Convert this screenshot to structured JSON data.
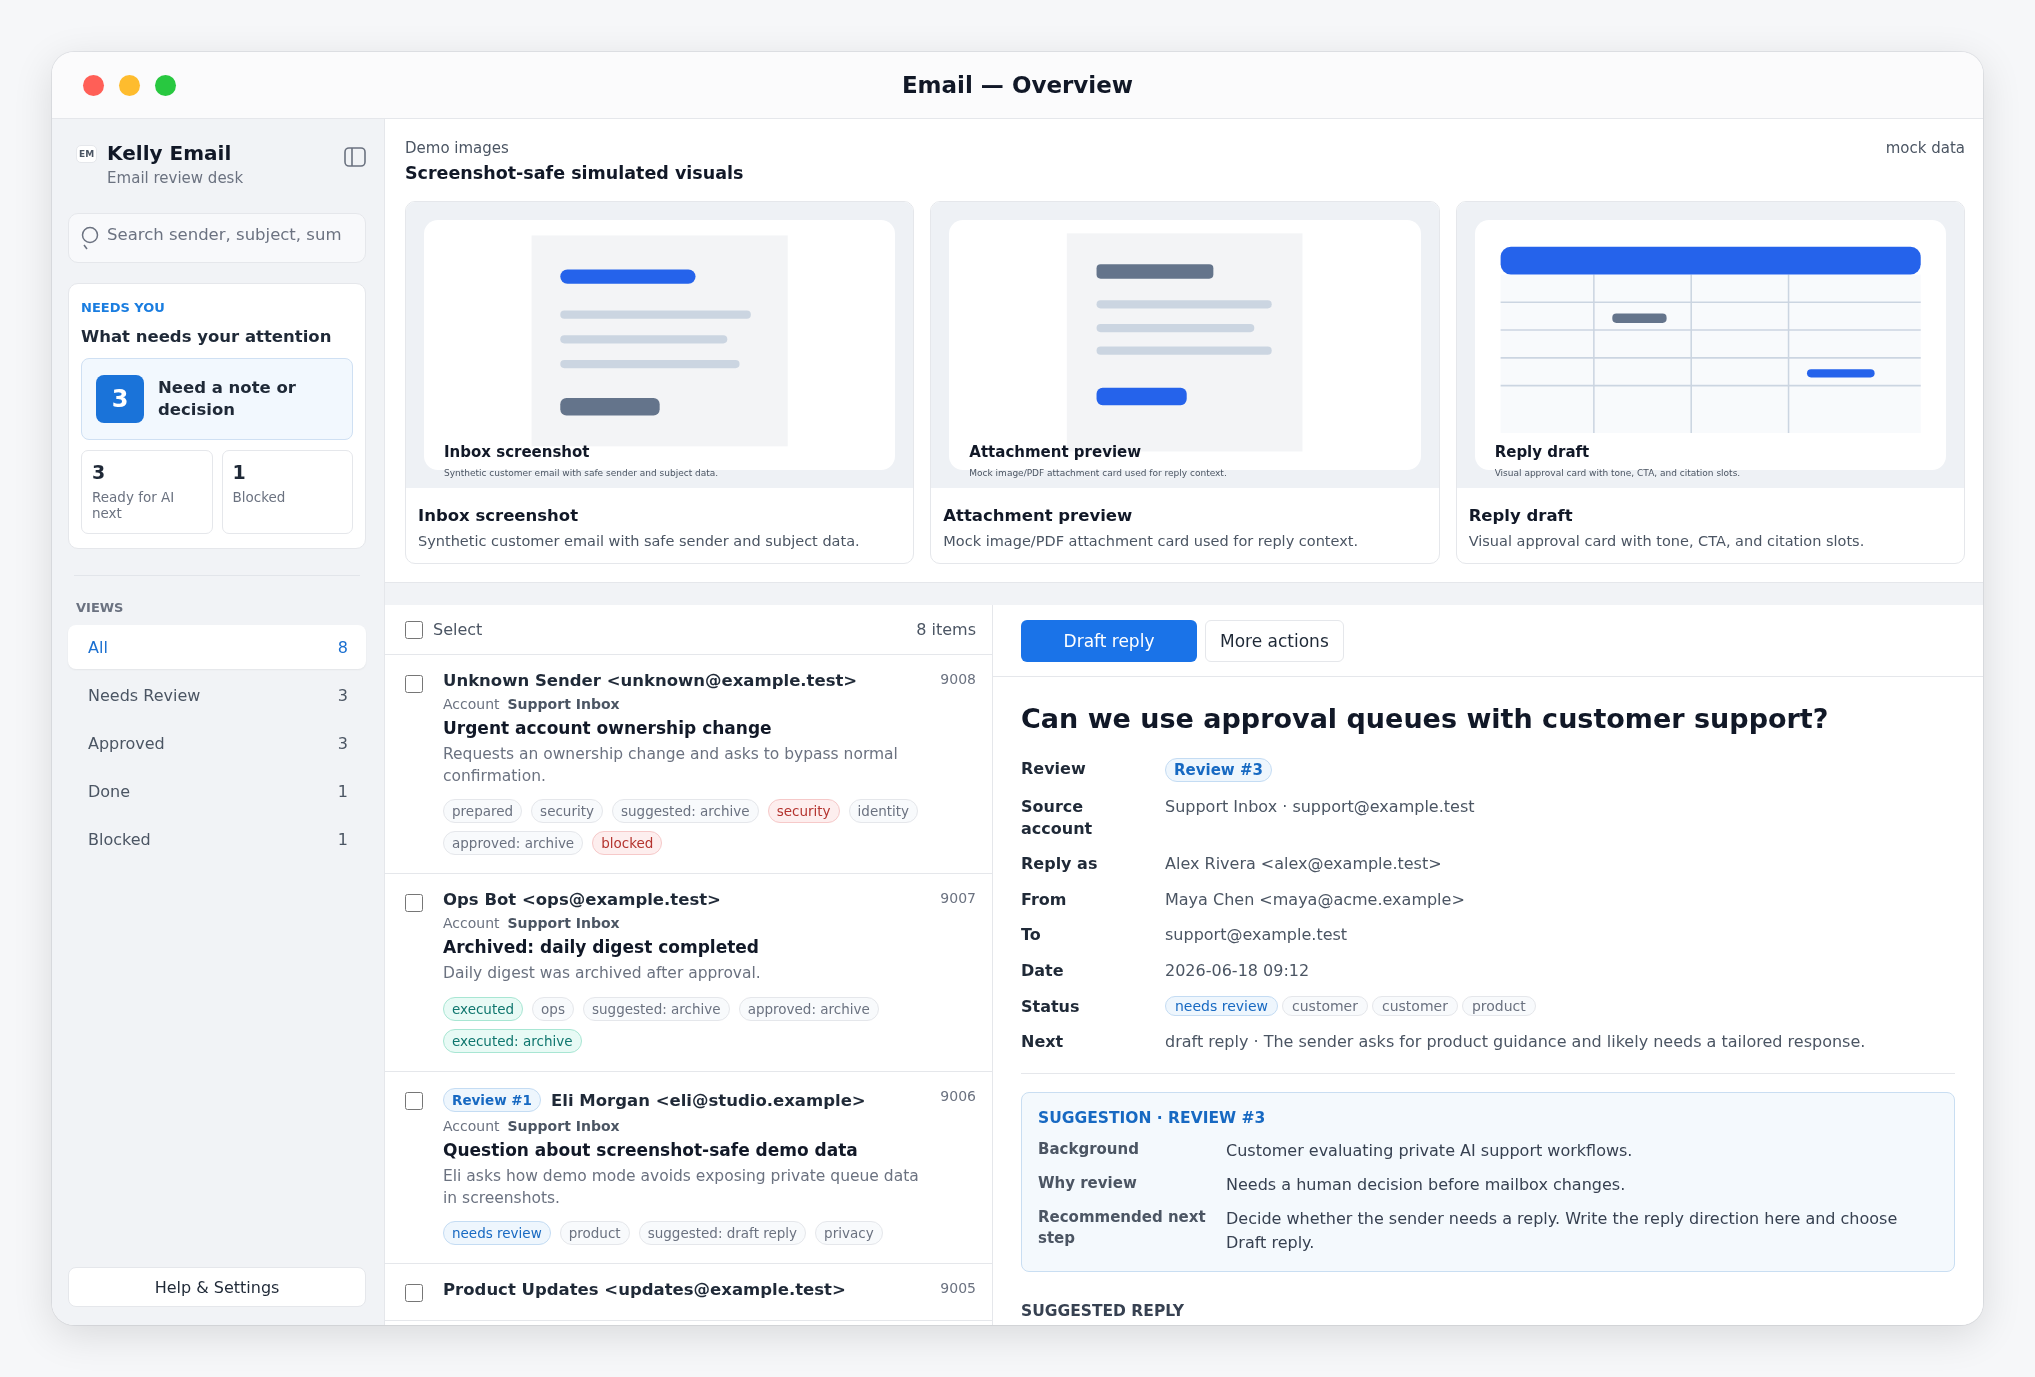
{
  "window": {
    "title": "Email — Overview"
  },
  "sidebar": {
    "logo": "EM",
    "app_name": "Kelly Email",
    "subtitle": "Email review desk",
    "search": {
      "placeholder": "Search sender, subject, sum"
    },
    "needs_you": {
      "eyebrow": "NEEDS YOU",
      "title": "What needs your attention",
      "primary": {
        "count": "3",
        "label": "Need a note or decision"
      },
      "stats": [
        {
          "count": "3",
          "label": "Ready for AI next"
        },
        {
          "count": "1",
          "label": "Blocked"
        }
      ]
    },
    "views_heading": "VIEWS",
    "views": [
      {
        "label": "All",
        "count": "8",
        "selected": true
      },
      {
        "label": "Needs Review",
        "count": "3",
        "selected": false
      },
      {
        "label": "Approved",
        "count": "3",
        "selected": false
      },
      {
        "label": "Done",
        "count": "1",
        "selected": false
      },
      {
        "label": "Blocked",
        "count": "1",
        "selected": false
      }
    ],
    "footer_button": "Help & Settings"
  },
  "demo": {
    "eyebrow": "Demo images",
    "title": "Screenshot-safe simulated visuals",
    "badge": "mock data",
    "cards": [
      {
        "kind": "inbox",
        "overlay_title": "Inbox screenshot",
        "overlay_caption": "Synthetic customer email with safe sender and subject data.",
        "title": "Inbox screenshot",
        "description": "Synthetic customer email with safe sender and subject data."
      },
      {
        "kind": "attachment",
        "overlay_title": "Attachment preview",
        "overlay_caption": "Mock image/PDF attachment card used for reply context.",
        "title": "Attachment preview",
        "description": "Mock image/PDF attachment card used for reply context."
      },
      {
        "kind": "table",
        "overlay_title": "Reply draft",
        "overlay_caption": "Visual approval card with tone, CTA, and citation slots.",
        "title": "Reply draft",
        "description": "Visual approval card with tone, CTA, and citation slots."
      }
    ]
  },
  "list": {
    "select_label": "Select",
    "select_checked": false,
    "count": "8 items",
    "rows": [
      {
        "checked": false,
        "sender": "Unknown Sender <unknown@example.test>",
        "number": "9008",
        "account_label": "Account",
        "account": "Support Inbox",
        "subject": "Urgent account ownership change",
        "summary": "Requests an ownership change and asks to bypass normal confirmation.",
        "tags": [
          {
            "label": "prepared",
            "kind": "neutral"
          },
          {
            "label": "security",
            "kind": "neutral"
          },
          {
            "label": "suggested: archive",
            "kind": "neutral"
          },
          {
            "label": "security",
            "kind": "danger"
          },
          {
            "label": "identity",
            "kind": "neutral"
          },
          {
            "label": "approved: archive",
            "kind": "neutral"
          },
          {
            "label": "blocked",
            "kind": "danger"
          }
        ]
      },
      {
        "checked": false,
        "sender": "Ops Bot <ops@example.test>",
        "number": "9007",
        "account_label": "Account",
        "account": "Support Inbox",
        "subject": "Archived: daily digest completed",
        "summary": "Daily digest was archived after approval.",
        "tags": [
          {
            "label": "executed",
            "kind": "success"
          },
          {
            "label": "ops",
            "kind": "neutral"
          },
          {
            "label": "suggested: archive",
            "kind": "neutral"
          },
          {
            "label": "approved: archive",
            "kind": "neutral"
          },
          {
            "label": "executed: archive",
            "kind": "success"
          }
        ]
      },
      {
        "checked": false,
        "review_badge": "Review #1",
        "sender": "Eli Morgan <eli@studio.example>",
        "number": "9006",
        "account_label": "Account",
        "account": "Support Inbox",
        "subject": "Question about screenshot-safe demo data",
        "summary": "Eli asks how demo mode avoids exposing private queue data in screenshots.",
        "tags": [
          {
            "label": "needs review",
            "kind": "info"
          },
          {
            "label": "product",
            "kind": "neutral"
          },
          {
            "label": "suggested: draft reply",
            "kind": "neutral"
          },
          {
            "label": "privacy",
            "kind": "neutral"
          }
        ]
      },
      {
        "checked": false,
        "sender": "Product Updates <updates@example.test>",
        "number": "9005"
      }
    ]
  },
  "detail": {
    "actions": [
      {
        "label": "Draft reply",
        "kind": "primary"
      },
      {
        "label": "More actions",
        "kind": "secondary"
      }
    ],
    "title": "Can we use approval queues with customer support?",
    "fields": [
      {
        "label": "Review",
        "kind": "pill",
        "value": "Review #3"
      },
      {
        "label": "Source account",
        "kind": "text",
        "value": "Support Inbox · support@example.test"
      },
      {
        "label": "Reply as",
        "kind": "text",
        "value": "Alex Rivera <alex@example.test>"
      },
      {
        "label": "From",
        "kind": "text",
        "value": "Maya Chen <maya@acme.example>"
      },
      {
        "label": "To",
        "kind": "text",
        "value": "support@example.test"
      },
      {
        "label": "Date",
        "kind": "text",
        "value": "2026-06-18 09:12"
      },
      {
        "label": "Status",
        "kind": "tags",
        "tags": [
          {
            "label": "needs review",
            "kind": "info"
          },
          {
            "label": "customer",
            "kind": "neutral"
          },
          {
            "label": "customer",
            "kind": "neutral"
          },
          {
            "label": "product",
            "kind": "neutral"
          }
        ]
      },
      {
        "label": "Next",
        "kind": "text",
        "value": "draft reply · The sender asks for product guidance and likely needs a tailored response."
      }
    ],
    "suggestion": {
      "heading": "SUGGESTION · REVIEW #3",
      "rows": [
        {
          "label": "Background",
          "value": "Customer evaluating private AI support workflows."
        },
        {
          "label": "Why review",
          "value": "Needs a human decision before mailbox changes."
        },
        {
          "label": "Recommended next step",
          "value": "Decide whether the sender needs a reply. Write the reply direction here and choose Draft reply."
        }
      ]
    },
    "suggested_reply_heading": "SUGGESTED REPLY"
  }
}
